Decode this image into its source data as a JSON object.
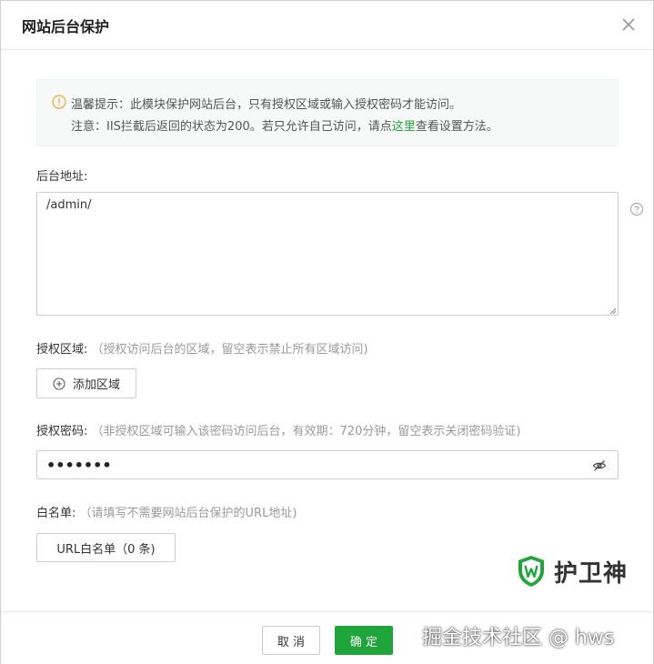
{
  "dialog": {
    "title": "网站后台保护"
  },
  "notice": {
    "line1": "温馨提示：此模块保护网站后台，只有授权区域或输入授权密码才能访问。",
    "line2_prefix": "注意：IIS拦截后返回的状态为200。若只允许自己访问，请点",
    "line2_link": "这里",
    "line2_suffix": "查看设置方法。"
  },
  "admin_path": {
    "label": "后台地址:",
    "value": "/admin/"
  },
  "auth_region": {
    "label": "授权区域:",
    "hint": "（授权访问后台的区域，留空表示禁止所有区域访问)",
    "add_button": "添加区域"
  },
  "auth_password": {
    "label": "授权密码:",
    "hint": "（非授权区域可输入该密码访问后台，有效期：720分钟，留空表示关闭密码验证)",
    "value": "•••••••"
  },
  "whitelist": {
    "label": "白名单:",
    "hint": "（请填写不需要网站后台保护的URL地址)",
    "button": "URL白名单（0 条)"
  },
  "footer": {
    "cancel_label": "取 消",
    "confirm_label": "确 定"
  },
  "branding": {
    "logo_text": "护卫神",
    "watermark": "掘金技术社区 @ hws"
  },
  "colors": {
    "accent": "#20a53a",
    "warning": "#f0ad4e",
    "notice_bg": "#f6f9f8"
  },
  "icons": {
    "close": "close-icon",
    "warning": "warning-icon",
    "help": "help-icon",
    "add": "plus-circle-icon",
    "eye": "eye-off-icon",
    "shield": "shield-logo-icon"
  }
}
